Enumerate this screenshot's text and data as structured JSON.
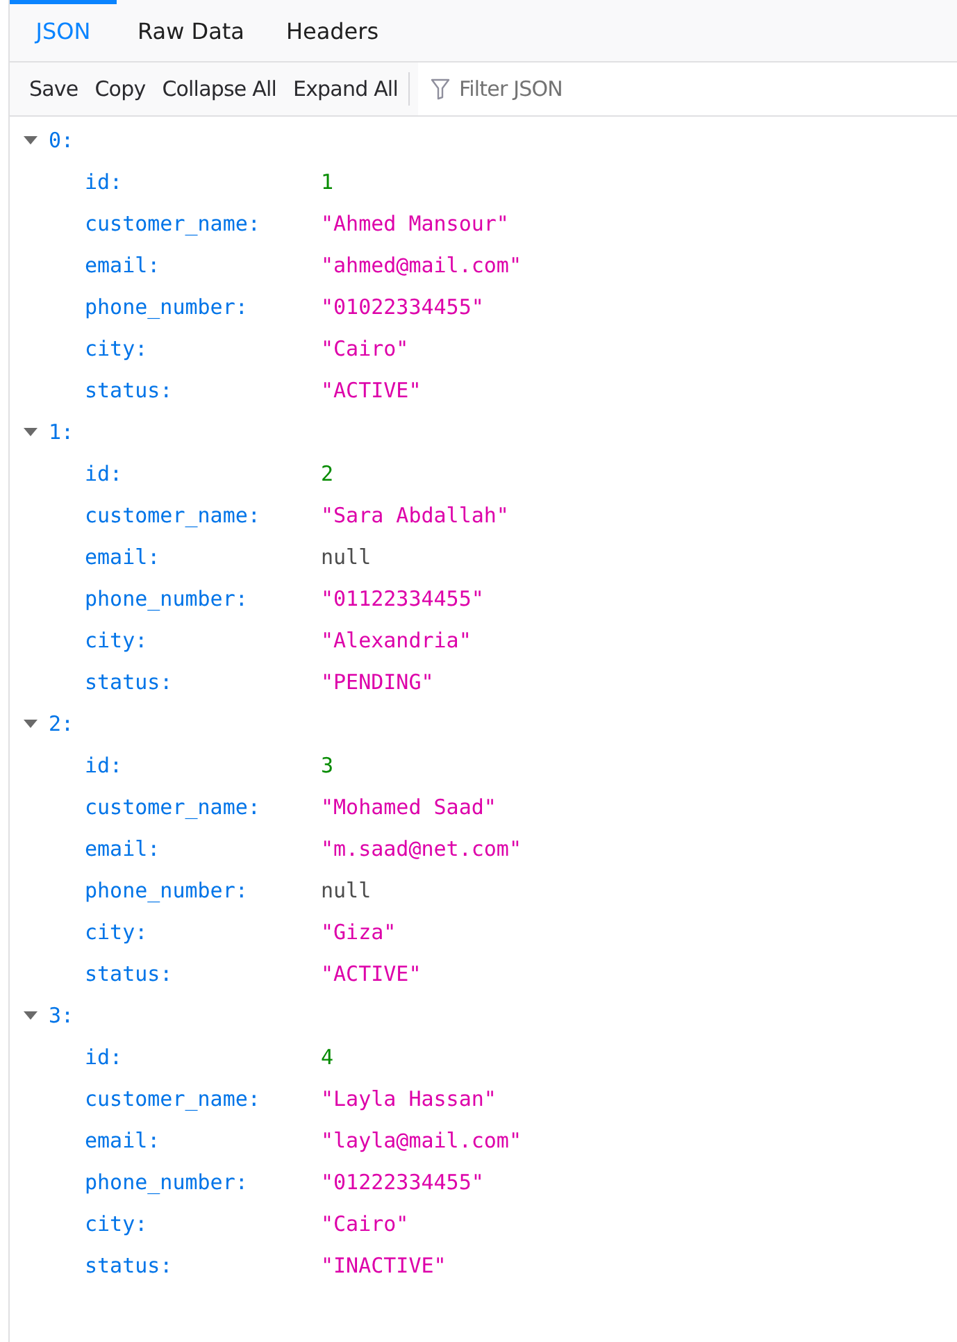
{
  "tabs": [
    {
      "label": "JSON",
      "selected": true
    },
    {
      "label": "Raw Data",
      "selected": false
    },
    {
      "label": "Headers",
      "selected": false
    }
  ],
  "toolbar": {
    "buttons": [
      "Save",
      "Copy",
      "Collapse All",
      "Expand All"
    ],
    "filter": {
      "placeholder": "Filter JSON"
    }
  },
  "tree": [
    {
      "key": "0:",
      "expanded": true,
      "children": [
        {
          "key": "id:",
          "value": "1",
          "kind": "number"
        },
        {
          "key": "customer_name:",
          "value": "\"Ahmed Mansour\"",
          "kind": "string"
        },
        {
          "key": "email:",
          "value": "\"ahmed@mail.com\"",
          "kind": "string"
        },
        {
          "key": "phone_number:",
          "value": "\"01022334455\"",
          "kind": "string"
        },
        {
          "key": "city:",
          "value": "\"Cairo\"",
          "kind": "string"
        },
        {
          "key": "status:",
          "value": "\"ACTIVE\"",
          "kind": "string"
        }
      ]
    },
    {
      "key": "1:",
      "expanded": true,
      "children": [
        {
          "key": "id:",
          "value": "2",
          "kind": "number"
        },
        {
          "key": "customer_name:",
          "value": "\"Sara Abdallah\"",
          "kind": "string"
        },
        {
          "key": "email:",
          "value": "null",
          "kind": "null"
        },
        {
          "key": "phone_number:",
          "value": "\"01122334455\"",
          "kind": "string"
        },
        {
          "key": "city:",
          "value": "\"Alexandria\"",
          "kind": "string"
        },
        {
          "key": "status:",
          "value": "\"PENDING\"",
          "kind": "string"
        }
      ]
    },
    {
      "key": "2:",
      "expanded": true,
      "children": [
        {
          "key": "id:",
          "value": "3",
          "kind": "number"
        },
        {
          "key": "customer_name:",
          "value": "\"Mohamed Saad\"",
          "kind": "string"
        },
        {
          "key": "email:",
          "value": "\"m.saad@net.com\"",
          "kind": "string"
        },
        {
          "key": "phone_number:",
          "value": "null",
          "kind": "null"
        },
        {
          "key": "city:",
          "value": "\"Giza\"",
          "kind": "string"
        },
        {
          "key": "status:",
          "value": "\"ACTIVE\"",
          "kind": "string"
        }
      ]
    },
    {
      "key": "3:",
      "expanded": true,
      "children": [
        {
          "key": "id:",
          "value": "4",
          "kind": "number"
        },
        {
          "key": "customer_name:",
          "value": "\"Layla Hassan\"",
          "kind": "string"
        },
        {
          "key": "email:",
          "value": "\"layla@mail.com\"",
          "kind": "string"
        },
        {
          "key": "phone_number:",
          "value": "\"01222334455\"",
          "kind": "string"
        },
        {
          "key": "city:",
          "value": "\"Cairo\"",
          "kind": "string"
        },
        {
          "key": "status:",
          "value": "\"INACTIVE\"",
          "kind": "string"
        }
      ]
    }
  ]
}
